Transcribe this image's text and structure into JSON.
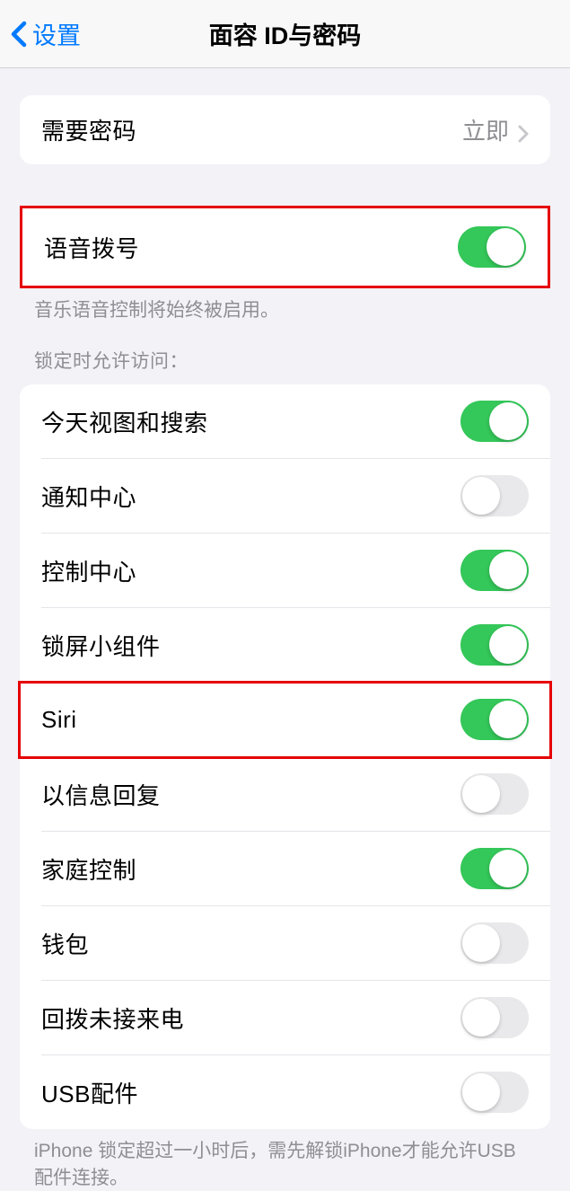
{
  "nav": {
    "back": "设置",
    "title": "面容 ID与密码"
  },
  "passcode": {
    "label": "需要密码",
    "value": "立即"
  },
  "voiceDial": {
    "label": "语音拨号",
    "footer": "音乐语音控制将始终被启用。"
  },
  "lockAccess": {
    "header": "锁定时允许访问：",
    "items": [
      {
        "label": "今天视图和搜索",
        "on": true
      },
      {
        "label": "通知中心",
        "on": false
      },
      {
        "label": "控制中心",
        "on": true
      },
      {
        "label": "锁屏小组件",
        "on": true
      },
      {
        "label": "Siri",
        "on": true
      },
      {
        "label": "以信息回复",
        "on": false
      },
      {
        "label": "家庭控制",
        "on": true
      },
      {
        "label": "钱包",
        "on": false
      },
      {
        "label": "回拨未接来电",
        "on": false
      },
      {
        "label": "USB配件",
        "on": false
      }
    ],
    "footer": "iPhone 锁定超过一小时后，需先解锁iPhone才能允许USB 配件连接。"
  }
}
